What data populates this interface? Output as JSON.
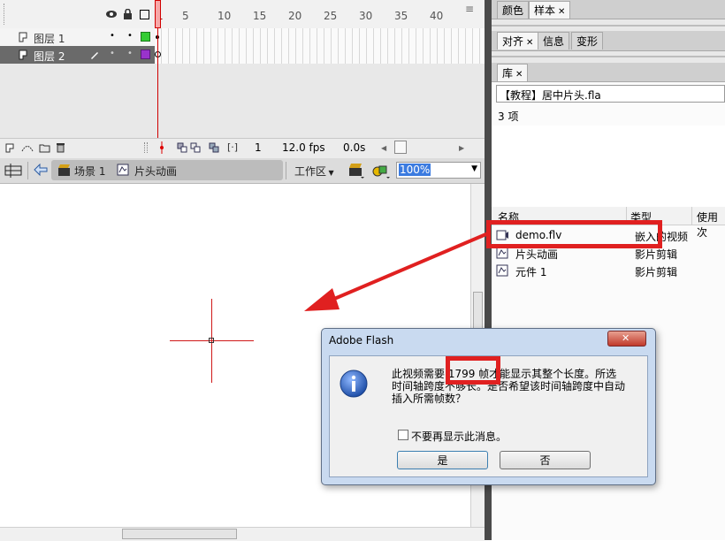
{
  "timeline": {
    "frame_numbers": [
      "1",
      "5",
      "10",
      "15",
      "20",
      "25",
      "30",
      "35",
      "40"
    ],
    "layers": [
      {
        "name": "图层 1",
        "color": "#33cc33"
      },
      {
        "name": "图层 2",
        "color": "#9933cc"
      }
    ],
    "status": {
      "frame": "1",
      "fps": "12.0 fps",
      "time": "0.0s"
    }
  },
  "editbar": {
    "scene": "场景 1",
    "symbol": "片头动画",
    "workspace": "工作区",
    "zoom": "100%"
  },
  "right_panel": {
    "tabs_top": [
      "颜色",
      "样本"
    ],
    "tabs_mid": [
      "对齐",
      "信息",
      "变形"
    ],
    "library_tab": "库",
    "document": "【教程】居中片头.fla",
    "item_count": "3 项",
    "columns": [
      "名称",
      "类型",
      "使用次"
    ],
    "items": [
      {
        "name": "demo.flv",
        "type": "嵌入的视频",
        "icon": "video-icon"
      },
      {
        "name": "片头动画",
        "type": "影片剪辑",
        "icon": "movieclip-icon"
      },
      {
        "name": "元件 1",
        "type": "影片剪辑",
        "icon": "movieclip-icon"
      }
    ]
  },
  "dialog": {
    "title": "Adobe Flash",
    "message_line1": "此视频需要 1799 帧才能显示其整个长度。所选",
    "message_line2": "时间轴跨度不够长。是否希望该时间轴跨度中自动",
    "message_line3": "插入所需帧数？",
    "checkbox_label": "不要再显示此消息。",
    "yes": "是",
    "no": "否"
  },
  "colors": {
    "highlight": "#e02020",
    "selection": "#3b7be0"
  }
}
